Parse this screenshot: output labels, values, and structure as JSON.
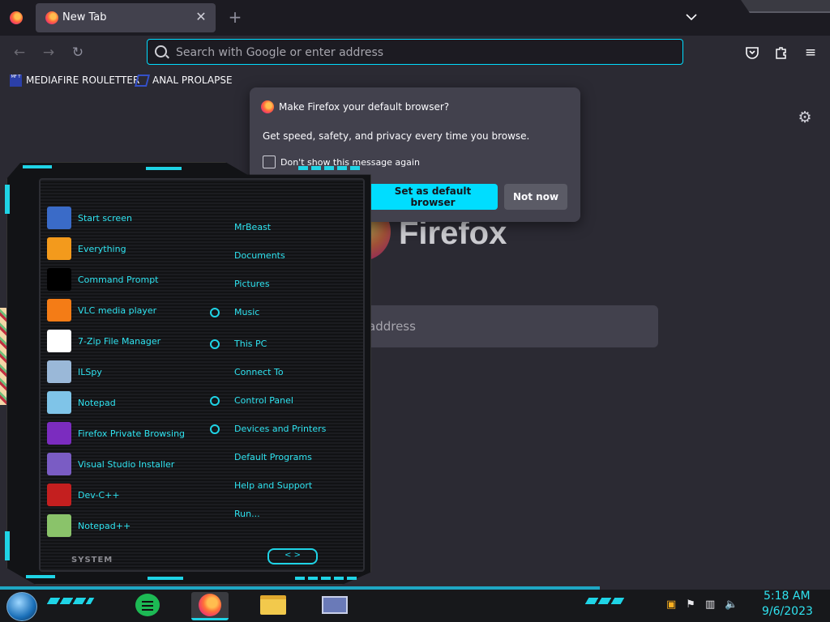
{
  "browser": {
    "tab_title": "New Tab",
    "tab_close": "✕",
    "new_tab": "+",
    "url_placeholder": "Search with Google or enter address",
    "bookmarks": [
      {
        "label": "MEDIAFIRE ROULETTER",
        "icon_text": "MF T"
      },
      {
        "label": "ANAL PROLAPSE"
      }
    ],
    "wordmark": "Firefox",
    "newtab_search_placeholder": "address"
  },
  "popup": {
    "title": "Make Firefox your default browser?",
    "body": "Get speed, safety, and privacy every time you browse.",
    "checkbox_label": "Don't show this message again",
    "primary_button": "Set as default browser",
    "secondary_button": "Not now"
  },
  "start_menu": {
    "left_items": [
      {
        "label": "Start screen",
        "icon": "start-screen-icon",
        "color": "#3a6bc8"
      },
      {
        "label": "Everything",
        "icon": "magnifier-icon",
        "color": "#f39a1c"
      },
      {
        "label": "Command Prompt",
        "icon": "cmd-icon",
        "color": "#000000"
      },
      {
        "label": "VLC media player",
        "icon": "vlc-cone-icon",
        "color": "#f47c16"
      },
      {
        "label": "7-Zip File Manager",
        "icon": "7zip-icon",
        "color": "#ffffff"
      },
      {
        "label": "ILSpy",
        "icon": "ilspy-icon",
        "color": "#9ab8d8"
      },
      {
        "label": "Notepad",
        "icon": "notepad-icon",
        "color": "#7fc4e8"
      },
      {
        "label": "Firefox Private Browsing",
        "icon": "firefox-private-icon",
        "color": "#7b2cbf"
      },
      {
        "label": "Visual Studio Installer",
        "icon": "vs-installer-icon",
        "color": "#7a5cc4"
      },
      {
        "label": "Dev-C++",
        "icon": "devcpp-icon",
        "color": "#c41f1f"
      },
      {
        "label": "Notepad++",
        "icon": "notepadpp-icon",
        "color": "#8ac36a"
      }
    ],
    "right_items": [
      {
        "label": "MrBeast",
        "arrow": false
      },
      {
        "label": "Documents",
        "arrow": false
      },
      {
        "label": "Pictures",
        "arrow": false
      },
      {
        "label": "Music",
        "arrow": true
      },
      {
        "label": "This PC",
        "arrow": true
      },
      {
        "label": "Connect To",
        "arrow": false
      },
      {
        "label": "Control Panel",
        "arrow": true
      },
      {
        "label": "Devices and Printers",
        "arrow": true
      },
      {
        "label": "Default Programs",
        "arrow": false
      },
      {
        "label": "Help and Support",
        "arrow": false
      },
      {
        "label": "Run...",
        "arrow": false
      }
    ],
    "footer_label": "SYSTEM",
    "nav_arrows": "< >"
  },
  "taskbar": {
    "apps": [
      "notes-app-icon",
      "firefox-icon",
      "file-explorer-icon",
      "window-app-icon"
    ],
    "clock_time": "5:18 AM",
    "clock_date": "9/6/2023"
  },
  "colors": {
    "accent": "#00ddff",
    "menu_text": "#2fe3f0",
    "chrome_bg": "#1c1b22",
    "toolbar_bg": "#2b2a33"
  }
}
